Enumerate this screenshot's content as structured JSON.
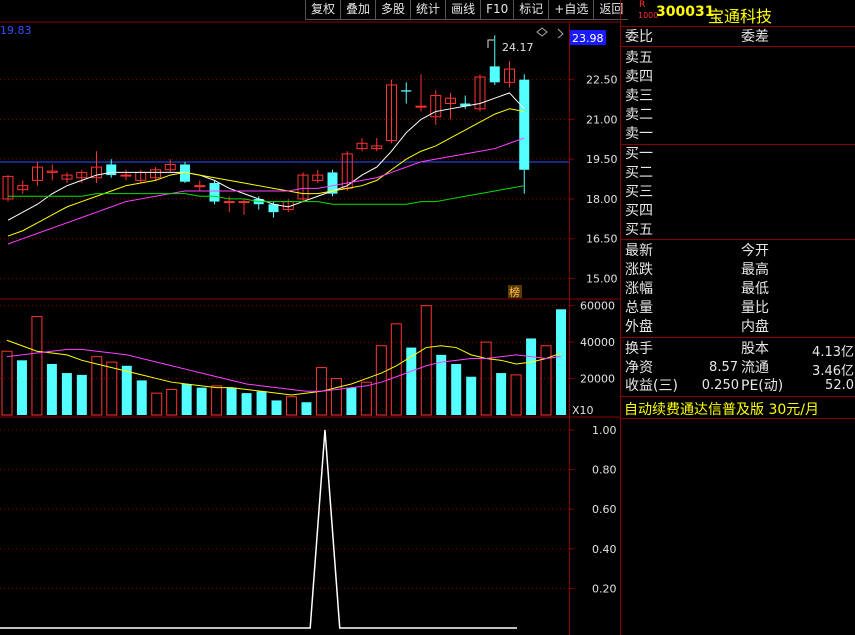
{
  "toolbar": {
    "buttons": [
      "复权",
      "叠加",
      "多股",
      "统计",
      "画线",
      "F10",
      "标记",
      "+自选",
      "返回"
    ]
  },
  "stock": {
    "badge_top": "R",
    "badge_bottom": "1000",
    "code": "300031",
    "name": "宝通科技"
  },
  "main_chart": {
    "left_price_label": "19.83",
    "current_price_tag": "23.98",
    "high_annotation": "24.17",
    "y_ticks": [
      "22.50",
      "21.00",
      "19.50",
      "18.00",
      "16.50",
      "15.00"
    ],
    "y_range": [
      14.3,
      24.6
    ],
    "list_marker": "榜"
  },
  "volume_chart": {
    "y_ticks": [
      "60000",
      "40000",
      "20000"
    ],
    "y_range": [
      0,
      62000
    ],
    "unit": "X10"
  },
  "indicator_chart": {
    "y_ticks": [
      "1.00",
      "0.80",
      "0.60",
      "0.40",
      "0.20"
    ],
    "y_range": [
      0,
      1.05
    ],
    "peak_index": 22
  },
  "order_book": {
    "header_left": "委比",
    "header_right": "委差",
    "sell_labels": [
      "卖五",
      "卖四",
      "卖三",
      "卖二",
      "卖一"
    ],
    "buy_labels": [
      "买一",
      "买二",
      "买三",
      "买四",
      "买五"
    ]
  },
  "quote": {
    "rows": [
      {
        "left": "最新",
        "right": "今开"
      },
      {
        "left": "涨跌",
        "right": "最高"
      },
      {
        "left": "涨幅",
        "right": "最低"
      },
      {
        "left": "总量",
        "right": "量比"
      },
      {
        "left": "外盘",
        "right": "内盘"
      }
    ]
  },
  "fundamentals": {
    "turnover_label": "换手",
    "share_capital_label": "股本",
    "share_capital_value": "4.13亿",
    "net_asset_label": "净资",
    "net_asset_value": "8.57",
    "float_label": "流通",
    "float_value": "3.46亿",
    "eps_label": "收益(三)",
    "eps_value": "0.250",
    "pe_label": "PE(动)",
    "pe_value": "52.0"
  },
  "ad": {
    "text": "自动续费通达信普及版",
    "price": "30元/月"
  },
  "colors": {
    "up": "#ff3232",
    "down": "#54ffff",
    "ma5": "#ffffff",
    "ma10": "#ffff00",
    "ma20": "#ff40ff",
    "ma60": "#00e000",
    "grid": "#8b0000",
    "blue_line": "#3050ff"
  },
  "chart_data": [
    {
      "type": "candlestick",
      "title": "",
      "series": [
        {
          "name": "candles",
          "values": [
            {
              "o": 18.0,
              "c": 18.85,
              "h": 18.9,
              "l": 17.9
            },
            {
              "o": 18.35,
              "c": 18.5,
              "h": 18.7,
              "l": 18.2
            },
            {
              "o": 18.7,
              "c": 19.2,
              "h": 19.4,
              "l": 18.5
            },
            {
              "o": 19.0,
              "c": 19.05,
              "h": 19.3,
              "l": 18.7
            },
            {
              "o": 18.75,
              "c": 18.9,
              "h": 19.0,
              "l": 18.6
            },
            {
              "o": 18.8,
              "c": 19.0,
              "h": 19.1,
              "l": 18.6
            },
            {
              "o": 18.8,
              "c": 19.2,
              "h": 19.8,
              "l": 18.6
            },
            {
              "o": 19.3,
              "c": 18.9,
              "h": 19.5,
              "l": 18.8
            },
            {
              "o": 18.9,
              "c": 18.9,
              "h": 19.1,
              "l": 18.7
            },
            {
              "o": 18.7,
              "c": 19.0,
              "h": 19.1,
              "l": 18.6
            },
            {
              "o": 18.8,
              "c": 19.1,
              "h": 19.2,
              "l": 18.7
            },
            {
              "o": 19.1,
              "c": 19.3,
              "h": 19.5,
              "l": 19.0
            },
            {
              "o": 19.3,
              "c": 18.65,
              "h": 19.4,
              "l": 18.6
            },
            {
              "o": 18.5,
              "c": 18.5,
              "h": 18.7,
              "l": 18.3
            },
            {
              "o": 18.6,
              "c": 17.9,
              "h": 18.7,
              "l": 17.8
            },
            {
              "o": 17.9,
              "c": 17.9,
              "h": 18.1,
              "l": 17.5
            },
            {
              "o": 17.9,
              "c": 17.9,
              "h": 18.0,
              "l": 17.4
            },
            {
              "o": 18.0,
              "c": 17.8,
              "h": 18.1,
              "l": 17.6
            },
            {
              "o": 17.8,
              "c": 17.5,
              "h": 17.9,
              "l": 17.3
            },
            {
              "o": 17.6,
              "c": 17.9,
              "h": 18.0,
              "l": 17.5
            },
            {
              "o": 18.0,
              "c": 18.9,
              "h": 19.0,
              "l": 17.9
            },
            {
              "o": 18.7,
              "c": 18.9,
              "h": 19.1,
              "l": 18.6
            },
            {
              "o": 19.0,
              "c": 18.2,
              "h": 19.1,
              "l": 18.1
            },
            {
              "o": 18.4,
              "c": 19.7,
              "h": 19.8,
              "l": 18.3
            },
            {
              "o": 19.9,
              "c": 20.1,
              "h": 20.3,
              "l": 19.8
            },
            {
              "o": 19.9,
              "c": 20.0,
              "h": 20.3,
              "l": 19.8
            },
            {
              "o": 20.2,
              "c": 22.3,
              "h": 22.5,
              "l": 20.1
            },
            {
              "o": 22.1,
              "c": 22.05,
              "h": 22.4,
              "l": 21.6
            },
            {
              "o": 21.5,
              "c": 21.5,
              "h": 22.7,
              "l": 21.3
            },
            {
              "o": 21.1,
              "c": 21.9,
              "h": 22.1,
              "l": 20.8
            },
            {
              "o": 21.6,
              "c": 21.8,
              "h": 22.0,
              "l": 21.0
            },
            {
              "o": 21.6,
              "c": 21.5,
              "h": 21.9,
              "l": 21.4
            },
            {
              "o": 21.4,
              "c": 22.6,
              "h": 22.7,
              "l": 21.3
            },
            {
              "o": 23.0,
              "c": 22.4,
              "h": 24.17,
              "l": 22.3
            },
            {
              "o": 22.4,
              "c": 22.9,
              "h": 23.2,
              "l": 22.2
            },
            {
              "o": 22.5,
              "c": 19.1,
              "h": 22.7,
              "l": 18.2
            }
          ]
        },
        {
          "name": "MA5",
          "values": [
            17.2,
            17.5,
            17.8,
            18.2,
            18.5,
            18.7,
            18.9,
            19.0,
            19.0,
            19.0,
            19.0,
            19.0,
            19.0,
            18.9,
            18.7,
            18.4,
            18.2,
            18.0,
            17.8,
            17.7,
            17.9,
            18.1,
            18.3,
            18.5,
            18.9,
            19.2,
            19.8,
            20.5,
            21.0,
            21.3,
            21.4,
            21.5,
            21.6,
            21.8,
            22.0,
            21.4
          ]
        },
        {
          "name": "MA10",
          "values": [
            16.6,
            16.8,
            17.1,
            17.4,
            17.7,
            17.9,
            18.1,
            18.3,
            18.5,
            18.6,
            18.7,
            18.9,
            19.0,
            18.9,
            18.8,
            18.7,
            18.6,
            18.5,
            18.4,
            18.3,
            18.2,
            18.2,
            18.3,
            18.4,
            18.5,
            18.7,
            19.1,
            19.5,
            19.8,
            20.0,
            20.3,
            20.6,
            20.9,
            21.2,
            21.4,
            21.3
          ]
        },
        {
          "name": "MA20",
          "values": [
            16.3,
            16.5,
            16.7,
            16.9,
            17.1,
            17.3,
            17.5,
            17.7,
            17.9,
            18.0,
            18.1,
            18.2,
            18.3,
            18.3,
            18.3,
            18.3,
            18.3,
            18.3,
            18.3,
            18.3,
            18.4,
            18.4,
            18.5,
            18.6,
            18.7,
            18.8,
            19.0,
            19.2,
            19.4,
            19.5,
            19.6,
            19.7,
            19.8,
            19.9,
            20.1,
            20.3
          ]
        },
        {
          "name": "MA60",
          "values": [
            18.1,
            18.1,
            18.1,
            18.1,
            18.1,
            18.1,
            18.2,
            18.2,
            18.2,
            18.2,
            18.2,
            18.2,
            18.2,
            18.1,
            18.1,
            18.0,
            18.0,
            17.9,
            17.9,
            17.9,
            17.9,
            17.9,
            17.8,
            17.8,
            17.8,
            17.8,
            17.8,
            17.8,
            17.9,
            17.9,
            18.0,
            18.1,
            18.2,
            18.3,
            18.4,
            18.5
          ]
        }
      ]
    },
    {
      "type": "bar",
      "title": "",
      "values": [
        35000,
        30000,
        54000,
        28000,
        23000,
        22000,
        32000,
        29000,
        27000,
        19000,
        12000,
        14000,
        17000,
        15000,
        16000,
        15000,
        12000,
        13000,
        8000,
        10000,
        7000,
        26000,
        20000,
        15000,
        18000,
        38000,
        50000,
        37000,
        60000,
        33000,
        28000,
        21000,
        40000,
        23000,
        22000,
        42000,
        38000,
        58000
      ],
      "up": [
        true,
        false,
        true,
        false,
        false,
        false,
        true,
        true,
        false,
        false,
        true,
        true,
        false,
        false,
        true,
        false,
        false,
        false,
        false,
        true,
        false,
        true,
        true,
        false,
        true,
        true,
        true,
        false,
        true,
        false,
        false,
        false,
        true,
        false,
        true,
        false,
        true,
        false
      ],
      "series": [
        {
          "name": "MA5",
          "values": [
            41000,
            38000,
            35000,
            34000,
            33000,
            30000,
            28000,
            26000,
            24000,
            22000,
            20000,
            18000,
            17000,
            16000,
            15000,
            15000,
            14000,
            13000,
            12000,
            11000,
            12000,
            13000,
            15000,
            17000,
            20000,
            23000,
            27000,
            32000,
            37000,
            38000,
            37000,
            33000,
            31000,
            30000,
            28000,
            29000,
            31000,
            34000
          ]
        },
        {
          "name": "MA10",
          "values": [
            32000,
            33000,
            34000,
            35000,
            36000,
            36000,
            35000,
            34000,
            33000,
            31000,
            29000,
            27000,
            25000,
            23000,
            21000,
            19000,
            17000,
            16000,
            15000,
            14000,
            13000,
            13000,
            14000,
            15000,
            16000,
            18000,
            21000,
            24000,
            27000,
            29000,
            30000,
            31000,
            31000,
            32000,
            33000,
            32000,
            31000,
            32000
          ]
        }
      ]
    },
    {
      "type": "line",
      "title": "",
      "values": [
        0,
        0,
        0,
        0,
        0,
        0,
        0,
        0,
        0,
        0,
        0,
        0,
        0,
        0,
        0,
        0,
        0,
        0,
        0,
        0,
        0,
        0,
        1,
        0,
        0,
        0,
        0,
        0,
        0,
        0,
        0,
        0,
        0,
        0,
        0,
        0
      ]
    }
  ]
}
